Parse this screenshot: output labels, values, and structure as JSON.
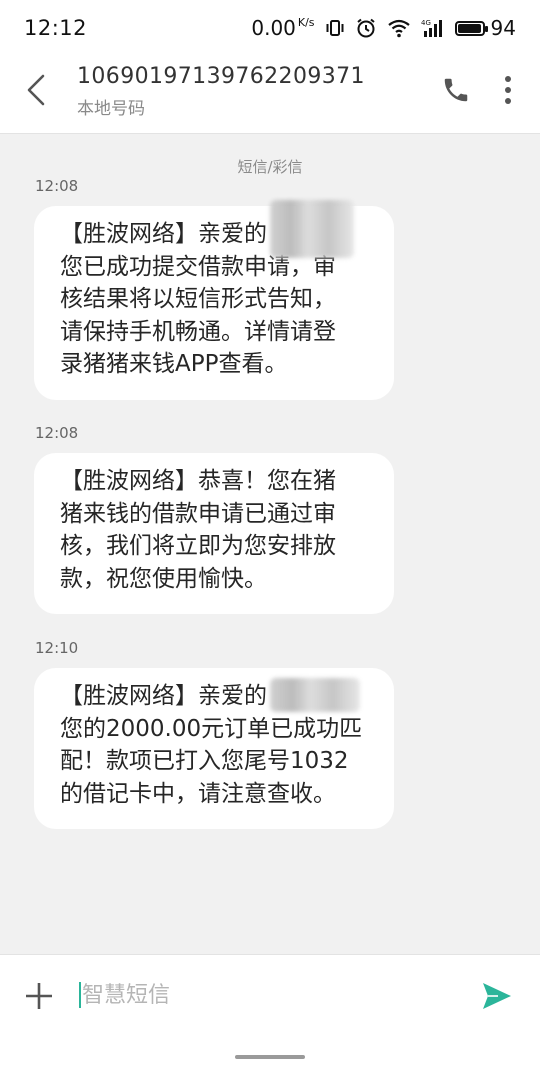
{
  "status_bar": {
    "time": "12:12",
    "net_speed": "0.00",
    "net_unit": "K/s",
    "battery_level": "94",
    "battery_fraction": 0.94,
    "icons": [
      "vibrate-icon",
      "alarm-icon",
      "wifi-icon",
      "signal-4g-icon",
      "battery-icon"
    ]
  },
  "header": {
    "contact_number": "10690197139762209371",
    "contact_subtitle": "本地号码",
    "icons": [
      "back-arrow-icon",
      "phone-icon",
      "more-vertical-icon"
    ]
  },
  "thread": {
    "channel_label": "短信/彩信",
    "messages": [
      {
        "time": "12:08",
        "lines": [
          "【胜波网络】亲爱的",
          "您已成功提交借款申请，审",
          "核结果将以短信形式告知，",
          "请保持手机畅通。详情请登",
          "录猪猪来钱APP查看。"
        ]
      },
      {
        "time": "12:08",
        "lines": [
          "【胜波网络】恭喜！您在猪",
          "猪来钱的借款申请已通过审",
          "核，我们将立即为您安排放",
          "款，祝您使用愉快。"
        ]
      },
      {
        "time": "12:10",
        "lines": [
          "【胜波网络】亲爱的",
          "您的2000.00元订单已成功匹",
          "配！款项已打入您尾号1032",
          "的借记卡中，请注意查收。"
        ]
      }
    ]
  },
  "compose": {
    "placeholder": "智慧短信",
    "value": "",
    "icons": [
      "plus-icon",
      "send-icon"
    ]
  },
  "colors": {
    "accent": "#2bb59a",
    "background": "#f1f1f1",
    "bubble": "#ffffff"
  }
}
